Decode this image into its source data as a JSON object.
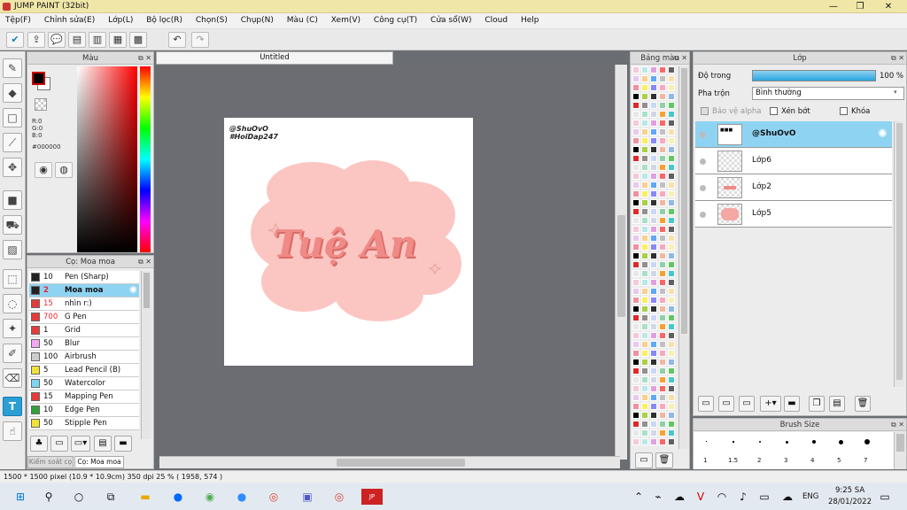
{
  "window": {
    "title": "JUMP PAINT (32bit)"
  },
  "menu": [
    "Tệp(F)",
    "Chỉnh sửa(E)",
    "Lớp(L)",
    "Bộ lọc(R)",
    "Chọn(S)",
    "Chụp(N)",
    "Màu (C)",
    "Xem(V)",
    "Công cụ(T)",
    "Cửa sổ(W)",
    "Cloud",
    "Help"
  ],
  "color_panel": {
    "title": "Màu",
    "r": "R:0",
    "g": "G:0",
    "b": "B:0",
    "hex": "#000000"
  },
  "brush_panel": {
    "title": "Cọ: Moa moa",
    "brushes": [
      {
        "size": "10",
        "name": "Pen (Sharp)",
        "color": "#222222"
      },
      {
        "size": "2",
        "name": "Moa moa",
        "color": "#222222"
      },
      {
        "size": "15",
        "name": "nhìn r:)",
        "color": "#e63b3b"
      },
      {
        "size": "700",
        "name": "G Pen",
        "color": "#e63b3b"
      },
      {
        "size": "1",
        "name": "Grid",
        "color": "#e63b3b"
      },
      {
        "size": "50",
        "name": "Blur",
        "color": "#f5a6f2"
      },
      {
        "size": "100",
        "name": "Airbrush",
        "color": "#cccccc"
      },
      {
        "size": "5",
        "name": "Lead Pencil (B)",
        "color": "#f2e235"
      },
      {
        "size": "50",
        "name": "Watercolor",
        "color": "#7fd6f0"
      },
      {
        "size": "15",
        "name": "Mapping Pen",
        "color": "#e63b3b"
      },
      {
        "size": "10",
        "name": "Edge Pen",
        "color": "#2fa33a"
      },
      {
        "size": "50",
        "name": "Stipple Pen",
        "color": "#f2e235"
      }
    ],
    "tabs": [
      "Kiểm soát cọ",
      "Cọ: Moa moa"
    ]
  },
  "canvas": {
    "tab": "Untitled",
    "watermark_line1": "@ShuOvO",
    "watermark_line2": "#HoiDap247",
    "artwork_text": "Tuệ An"
  },
  "palette_panel": {
    "title": "Bảng màu"
  },
  "layer_panel": {
    "title": "Lớp",
    "opacity_label": "Độ trong",
    "opacity_value": "100 %",
    "blend_label": "Pha trộn",
    "blend_value": "Bình thường",
    "protect_alpha": "Bảo vệ alpha",
    "clip": "Xén bớt",
    "lock": "Khóa",
    "layers": [
      "@ShuOvO",
      "Lớp6",
      "Lớp2",
      "Lớp5"
    ]
  },
  "brush_size_panel": {
    "title": "Brush Size",
    "sizes": [
      "1",
      "1.5",
      "2",
      "3",
      "4",
      "5",
      "7"
    ]
  },
  "status": {
    "text": "1500 * 1500 pixel   (10.9 * 10.9cm)   350 dpi   25 %   ( 1958, 574 )"
  },
  "taskbar": {
    "lang": "ENG",
    "time": "9:25 SA",
    "date": "28/01/2022"
  }
}
